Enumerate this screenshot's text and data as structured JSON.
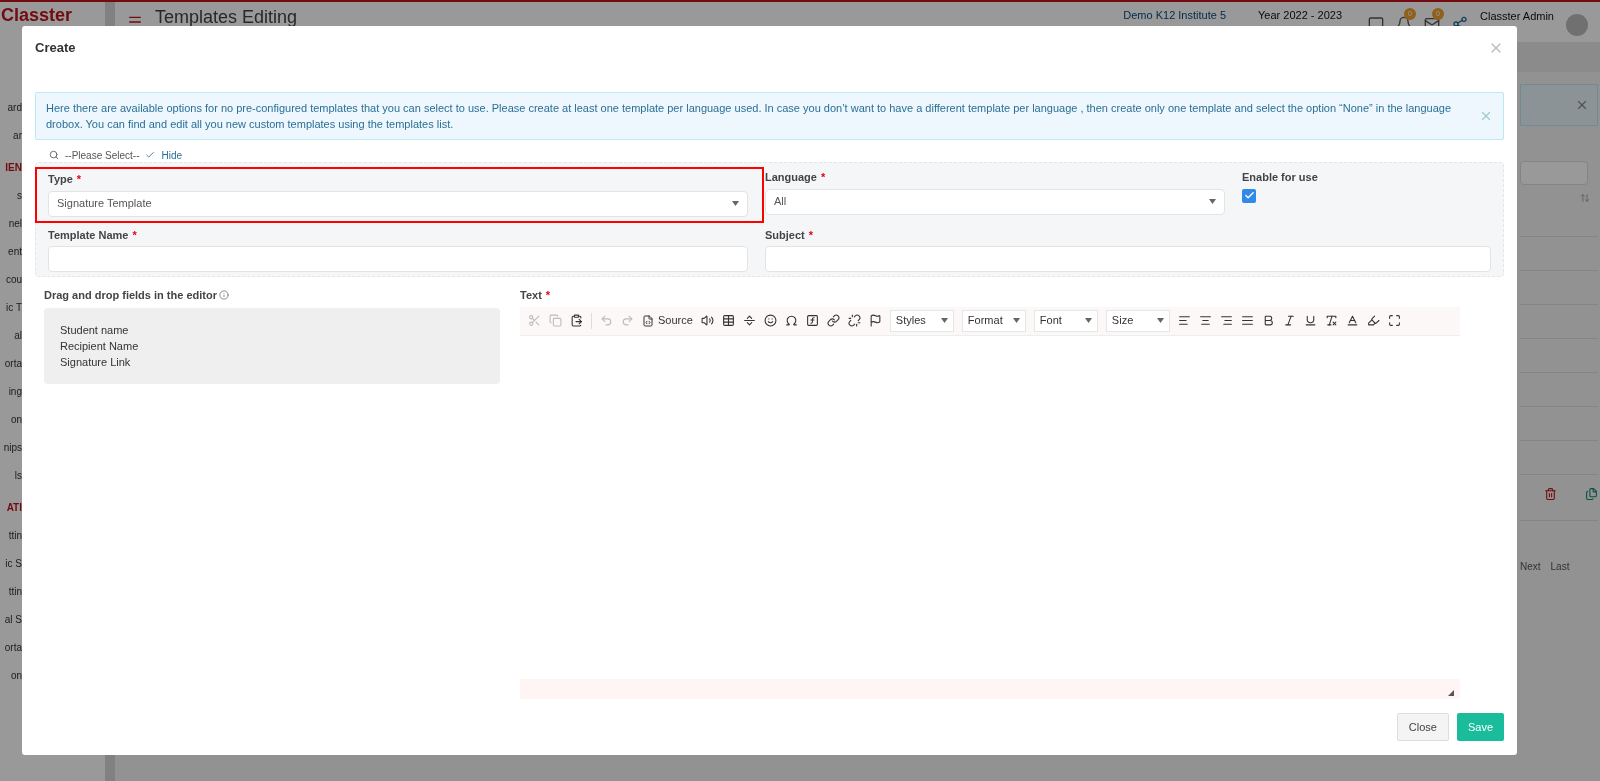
{
  "background": {
    "logo": "Classter",
    "page_title": "Templates Editing",
    "institute": "Demo K12 Institute 5",
    "year": "Year 2022 - 2023",
    "badges": [
      "0",
      "0"
    ],
    "user": "Classter Admin",
    "sidebar_items": [
      {
        "label": "ard",
        "kind": "item"
      },
      {
        "label": "ar",
        "kind": "item"
      },
      {
        "label": "IEN",
        "kind": "section"
      },
      {
        "label": "s",
        "kind": "item"
      },
      {
        "label": "nel",
        "kind": "item"
      },
      {
        "label": "ent",
        "kind": "item"
      },
      {
        "label": "cou",
        "kind": "item"
      },
      {
        "label": "ic T",
        "kind": "item"
      },
      {
        "label": "al",
        "kind": "item"
      },
      {
        "label": "orta",
        "kind": "item"
      },
      {
        "label": "ing",
        "kind": "item"
      },
      {
        "label": "on",
        "kind": "item"
      },
      {
        "label": "nips",
        "kind": "item"
      },
      {
        "label": "ls",
        "kind": "item"
      },
      {
        "label": "ATI",
        "kind": "section"
      },
      {
        "label": "ttin",
        "kind": "item"
      },
      {
        "label": "ic S",
        "kind": "item"
      },
      {
        "label": "ttin",
        "kind": "item"
      },
      {
        "label": "al S",
        "kind": "item"
      },
      {
        "label": "orta",
        "kind": "item"
      },
      {
        "label": "on",
        "kind": "item"
      }
    ],
    "pager": [
      "Next",
      "Last"
    ]
  },
  "dialog": {
    "title": "Create",
    "info": "Here there are available options for no pre-configured templates that you can select to use. Please create at least one template per language used. In case you don’t want to have a different template per language , then create only one template and select the option “None” in the language drobox. You can find and edit all you new custom templates using the templates list.",
    "selector": {
      "placeholder": "--Please Select--",
      "hide": "Hide"
    },
    "fields": [
      {
        "label": "Type",
        "required_mark": "*",
        "kind": "select",
        "value": "Signature Template",
        "highlighted": true
      },
      {
        "label": "Language",
        "required_mark": "*",
        "kind": "select",
        "value": "All",
        "highlighted": false
      },
      {
        "label": "Enable for use",
        "kind": "checkbox",
        "checked": true,
        "highlighted": false
      },
      {
        "label": "Template Name",
        "required_mark": "*",
        "kind": "text",
        "highlighted": false
      },
      {
        "label": "Subject",
        "required_mark": "*",
        "kind": "text",
        "highlighted": false
      }
    ],
    "merge_fields": {
      "title": "Drag and drop fields in the editor",
      "items": [
        "Student name",
        "Recipient Name",
        "Signature Link"
      ]
    },
    "editor": {
      "label": "Text",
      "required_mark": "*",
      "source": "Source",
      "dropdowns": [
        "Styles",
        "Format",
        "Font",
        "Size"
      ]
    },
    "buttons": [
      {
        "label": "Close",
        "kind": "secondary"
      },
      {
        "label": "Save",
        "kind": "primary"
      }
    ]
  }
}
